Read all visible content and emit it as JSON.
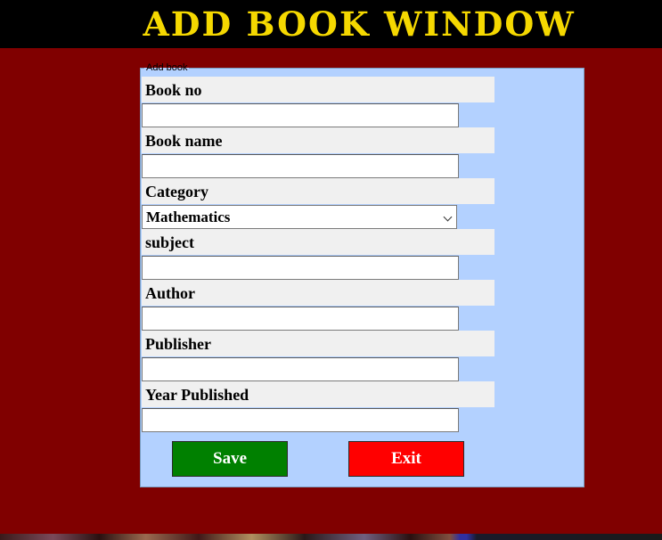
{
  "header": {
    "title": "ADD BOOK WINDOW"
  },
  "form": {
    "legend": "Add book",
    "fields": {
      "book_no": {
        "label": "Book no",
        "value": ""
      },
      "book_name": {
        "label": "Book name",
        "value": ""
      },
      "category": {
        "label": "Category",
        "selected": "Mathematics"
      },
      "subject": {
        "label": "subject",
        "value": ""
      },
      "author": {
        "label": "Author",
        "value": ""
      },
      "publisher": {
        "label": "Publisher",
        "value": ""
      },
      "year_published": {
        "label": "Year Published",
        "value": ""
      }
    },
    "buttons": {
      "save": "Save",
      "exit": "Exit"
    }
  },
  "colors": {
    "header_bg": "#000000",
    "title_text": "#f5d800",
    "window_bg": "#800000",
    "panel_bg": "#b3d1ff",
    "label_bg": "#f0f0f0",
    "save_button": "#008000",
    "exit_button": "#ff0000"
  },
  "icons": {
    "dropdown": "chevron-down-icon"
  }
}
